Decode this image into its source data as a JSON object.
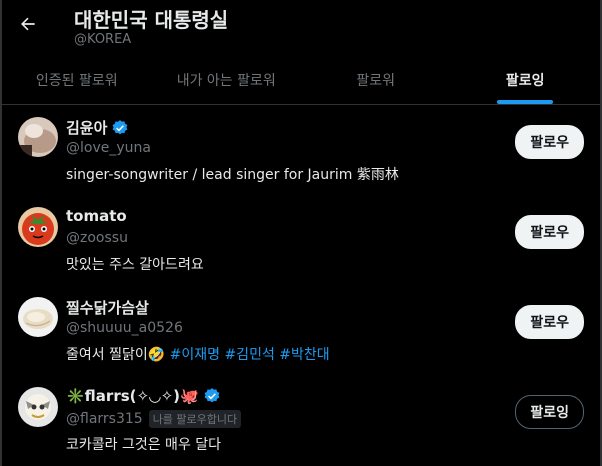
{
  "header": {
    "title": "대한민국 대통령실",
    "handle": "@KOREA"
  },
  "tabs": [
    {
      "label": "인증된 팔로워",
      "active": false
    },
    {
      "label": "내가 아는 팔로워",
      "active": false
    },
    {
      "label": "팔로워",
      "active": false
    },
    {
      "label": "팔로잉",
      "active": true
    }
  ],
  "colors": {
    "accent": "#1d9bf0",
    "background": "#000000",
    "text": "#e7e9ea",
    "muted": "#71767b"
  },
  "users": [
    {
      "name": "김윤아",
      "verified": true,
      "handle": "@love_yuna",
      "bio": "singer-songwriter / lead singer for Jaurim 紫雨林",
      "button": "팔로우",
      "avatar_icon": "face-photo-icon"
    },
    {
      "name": "tomato",
      "verified": false,
      "handle": "@zoossu",
      "bio": "맛있는 주스 갈아드려요",
      "button": "팔로우",
      "avatar_icon": "tomato-icon"
    },
    {
      "name": "찔수닭가슴살",
      "verified": false,
      "handle": "@shuuuu_a0526",
      "bio_text": "줄여서 찔닭이🤣",
      "bio_tags": [
        "#이재명",
        "#김민석",
        "#박찬대"
      ],
      "button": "팔로우",
      "avatar_icon": "chicken-breast-icon"
    },
    {
      "name": "✳️flarrs(✧◡✧)🐙",
      "verified": true,
      "handle": "@flarrs315",
      "follows_you": "나를 팔로우합니다",
      "bio": "코카콜라 그것은 매우 달다",
      "button": "팔로잉",
      "avatar_icon": "character-icon"
    }
  ]
}
